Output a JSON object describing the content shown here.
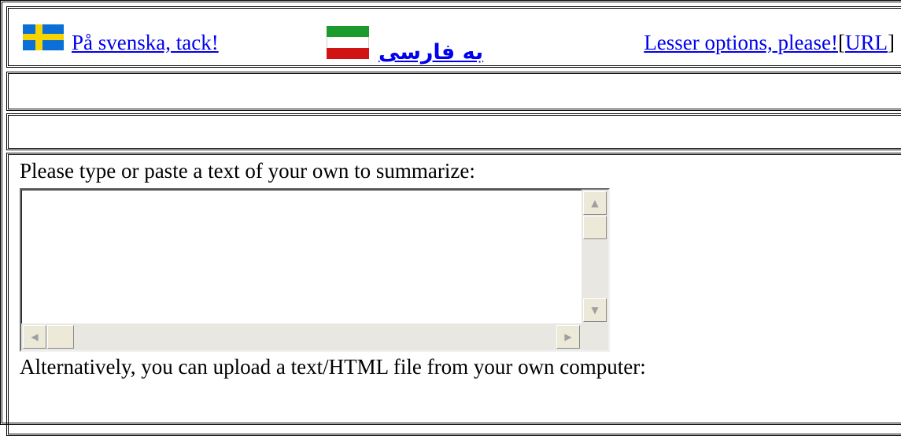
{
  "header": {
    "swedish_link": "På svenska, tack!",
    "persian_link": "به فارسی",
    "lesser_options_link": "Lesser options, please!",
    "url_bracket_open": "[",
    "url_link": "URL",
    "url_bracket_close": "]"
  },
  "form": {
    "paste_label": "Please type or paste a text of your own to summarize:",
    "textarea_value": "",
    "upload_label": "Alternatively, you can upload a text/HTML file from your own computer:"
  },
  "icons": {
    "swedish_flag": "sweden-flag-icon",
    "iran_flag": "iran-flag-icon",
    "scroll_up": "arrow-up-icon",
    "scroll_down": "arrow-down-icon",
    "scroll_left": "arrow-left-icon",
    "scroll_right": "arrow-right-icon"
  },
  "colors": {
    "link": "#0000ee",
    "swedish_blue": "#0a6fd6",
    "swedish_yellow": "#f7d300",
    "iran_green": "#1c9a2c",
    "iran_red": "#d01414",
    "scroll_track": "#e8e7e2"
  }
}
